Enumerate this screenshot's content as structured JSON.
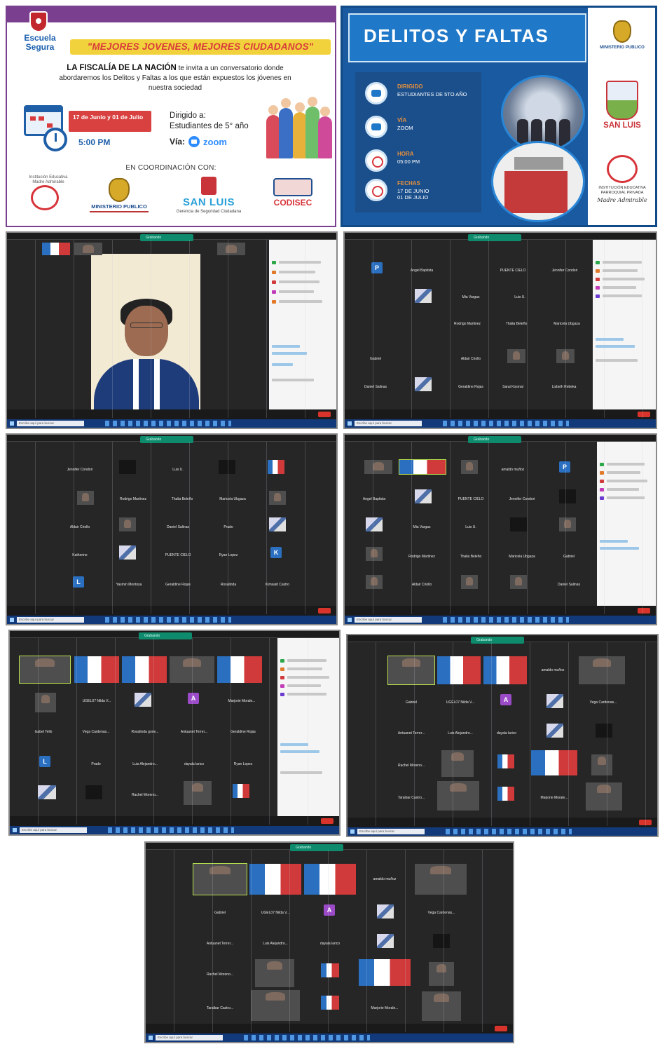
{
  "flyer1": {
    "brand": "Escuela Segura",
    "banner": "\"MEJORES JOVENES, MEJORES CIUDADANOS\"",
    "intro_strong": "LA FISCALÍA DE LA NACIÓN",
    "intro_rest": " te invita a un conversatorio donde abordaremos los Delitos y Faltas a los que están expuestos los jóvenes en nuestra sociedad",
    "dates": "17 de Junio y 01 de Julio",
    "time": "5:00 PM",
    "dirigido_label": "Dirigido a:",
    "dirigido_value": "Estudiantes de 5° año",
    "via_label": "Vía:",
    "via_value": "zoom",
    "coordination": "EN COORDINACIÓN CON:",
    "logo_heart_text": "Institución Educativa Madre Admirable",
    "logo_mp": "MINISTERIO PUBLICO",
    "logo_sl": "SAN LUIS",
    "logo_sl_sub": "Gerencia de Seguridad Ciudadana",
    "logo_codisec": "CODISEC"
  },
  "flyer2": {
    "title": "DELITOS Y FALTAS",
    "rows": [
      {
        "label": "DIRIGIDO",
        "value": "ESTUDIANTES DE 5TO AÑO",
        "icon": "student-icon"
      },
      {
        "label": "VÍA",
        "value": "ZOOM",
        "icon": "zoom-icon"
      },
      {
        "label": "HORA",
        "value": "05:00 PM",
        "icon": "clock-icon"
      },
      {
        "label": "FECHAS",
        "value": "17 DE JUNIO\n01 DE JULIO",
        "icon": "calendar-icon"
      }
    ],
    "logo_mp": "MINISTERIO PUBLICO",
    "logo_sl": "SAN LUIS",
    "logo_ma_text": "INSTITUCIÓN EDUCATIVA PARROQUIAL PRIVADA",
    "logo_ma_name": "Madre Admirable"
  },
  "shots": {
    "recording_label": "Grabando",
    "search_placeholder": "Escribe aquí para buscar",
    "s2": [
      "P",
      "Angel Baptista",
      "PUENTE CIELO",
      "Jennifer Condori",
      "Mia Vargas",
      "Luis U.",
      "Rodrigo Martinez",
      "Thalia Beleño",
      "Maricela Ubgaza",
      "Gabriel",
      "Aldair Criollo",
      "Daniel Salinas",
      "Geraldine Rojas",
      "Sarai Kosmal",
      "Lizbeth Rebeka"
    ],
    "s3": [
      "Jennifer Condori",
      "Luis U.",
      "Rodrigo Martinez",
      "Thalia Beleño",
      "Maricela Ubgaza",
      "Aldair Criollo",
      "Daniel Salinas",
      "Prado",
      "Katherine",
      "PUENTE CIELO",
      "Ryan Lopez",
      "K",
      "L",
      "Yasmin Montoya",
      "Geraldine Rojas",
      "Rosalinda",
      "Kimsaid Castro"
    ],
    "s4": [
      "amaldo muñoz",
      "P",
      "Angel Baptista",
      "PUENTE CIELO",
      "Jennifer Condori",
      "Mia Vargas",
      "Luis U.",
      "Rodrigo Martinez",
      "Thalia Beleño",
      "Maricela Ubgaza",
      "Gabriel",
      "Aldair Criollo",
      "Daniel Salinas"
    ],
    "s5": [
      "UGEL07 Nilda V...",
      "Marjorie Morale...",
      "A",
      "Isabel Tello",
      "Vega Cardenas...",
      "Rosalinda gone...",
      "Antuanet Terrer...",
      "Geraldine Rojas",
      "L",
      "Prado",
      "Luis Alejandro...",
      "dayala larico",
      "Ryan Lopez",
      "Rachel Moreno..."
    ],
    "s6": [
      "amaldo muñoz",
      "Gabriel",
      "UGEL07 Nilda V...",
      "A",
      "Vega Cardenas...",
      "Antuanet Terrer...",
      "Luis Alejandro...",
      "dayala larico",
      "Rachel Moreno...",
      "Taraibar Castro...",
      "Marjorie Morale..."
    ],
    "s7": [
      "amaldo muñoz",
      "Gabriel",
      "UGEL07 Nilda V...",
      "A",
      "Vega Cardenas...",
      "Antuanet Terrer...",
      "Luis Alejandro...",
      "dayala larico",
      "Rachel Moreno...",
      "Taraibar Castro...",
      "Marjorie Morale..."
    ]
  }
}
